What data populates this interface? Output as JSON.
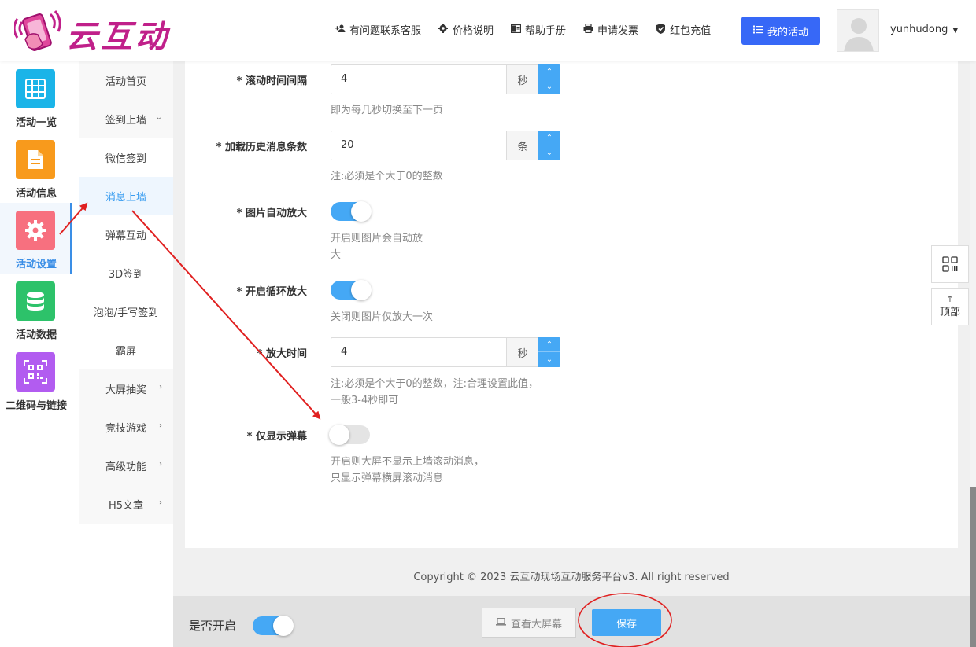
{
  "header": {
    "logo_text": "云互动",
    "nav": [
      {
        "label": "有问题联系客服",
        "icon": "user-plus-icon"
      },
      {
        "label": "价格说明",
        "icon": "gear-icon"
      },
      {
        "label": "帮助手册",
        "icon": "book-icon"
      },
      {
        "label": "申请发票",
        "icon": "printer-icon"
      },
      {
        "label": "红包充值",
        "icon": "shield-check-icon"
      }
    ],
    "my_activity_label": "我的活动",
    "username": "yunhudong"
  },
  "sidebar": {
    "items": [
      {
        "label": "活动一览",
        "icon": "grid-icon",
        "color": "#1bb4e8"
      },
      {
        "label": "活动信息",
        "icon": "document-icon",
        "color": "#f89a1c"
      },
      {
        "label": "活动设置",
        "icon": "gear-icon",
        "color": "#f7707f",
        "active": true
      },
      {
        "label": "活动数据",
        "icon": "database-icon",
        "color": "#2dc26a"
      },
      {
        "label": "二维码与链接",
        "icon": "qrcode-icon",
        "color": "#b25cf0"
      }
    ]
  },
  "submenu": {
    "items": [
      {
        "label": "活动首页"
      },
      {
        "label": "签到上墙",
        "arrow": "⌄"
      },
      {
        "label": "微信签到"
      },
      {
        "label": "消息上墙",
        "active": true
      },
      {
        "label": "弹幕互动"
      },
      {
        "label": "3D签到"
      },
      {
        "label": "泡泡/手写签到"
      },
      {
        "label": "霸屏"
      },
      {
        "label": "大屏抽奖",
        "arrow": "›"
      },
      {
        "label": "竞技游戏",
        "arrow": "›"
      },
      {
        "label": "高级功能",
        "arrow": "›"
      },
      {
        "label": "H5文章",
        "arrow": "›"
      }
    ]
  },
  "form": {
    "scroll_interval": {
      "label": "* 滚动时间间隔",
      "value": "4",
      "unit": "秒",
      "hint": "即为每几秒切换至下一页"
    },
    "history_count": {
      "label": "* 加载历史消息条数",
      "value": "20",
      "unit": "条",
      "hint": "注:必须是个大于0的整数"
    },
    "auto_zoom": {
      "label": "* 图片自动放大",
      "on": true,
      "hint_line1": "开启则图片会自动放",
      "hint_line2": "大"
    },
    "loop_zoom": {
      "label": "* 开启循环放大",
      "on": true,
      "hint": "关闭则图片仅放大一次"
    },
    "zoom_time": {
      "label": "* 放大时间",
      "value": "4",
      "unit": "秒",
      "hint_line1": "注:必须是个大于0的整数，注:合理设置此值，",
      "hint_line2": "一般3-4秒即可"
    },
    "danmu_only": {
      "label": "* 仅显示弹幕",
      "on": false,
      "hint_line1": "开启则大屏不显示上墙滚动消息，",
      "hint_line2": "只显示弹幕横屏滚动消息"
    }
  },
  "copyright": "Copyright © 2023 云互动现场互动服务平台v3. All right reserved",
  "footer": {
    "enable_label": "是否开启",
    "enable_on": true,
    "view_screen_label": "查看大屏幕",
    "save_label": "保存"
  },
  "float": {
    "top_label": "顶部",
    "top_arrow": "↑"
  },
  "colors": {
    "primary": "#45a8f5",
    "nav_button": "#3768f7",
    "annotation": "#e02020"
  }
}
